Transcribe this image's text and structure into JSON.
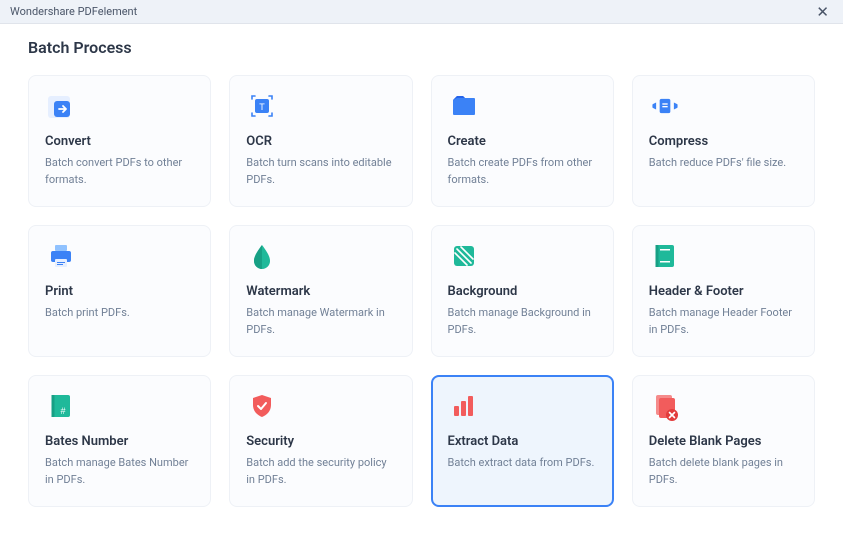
{
  "titlebar": {
    "title": "Wondershare PDFelement"
  },
  "page": {
    "title": "Batch Process"
  },
  "cards": [
    {
      "name": "convert",
      "title": "Convert",
      "desc": "Batch convert PDFs to other formats.",
      "selected": false
    },
    {
      "name": "ocr",
      "title": "OCR",
      "desc": "Batch turn scans into editable PDFs.",
      "selected": false
    },
    {
      "name": "create",
      "title": "Create",
      "desc": "Batch create PDFs from other formats.",
      "selected": false
    },
    {
      "name": "compress",
      "title": "Compress",
      "desc": "Batch reduce PDFs' file size.",
      "selected": false
    },
    {
      "name": "print",
      "title": "Print",
      "desc": "Batch print PDFs.",
      "selected": false
    },
    {
      "name": "watermark",
      "title": "Watermark",
      "desc": "Batch manage Watermark in PDFs.",
      "selected": false
    },
    {
      "name": "background",
      "title": "Background",
      "desc": "Batch manage Background in PDFs.",
      "selected": false
    },
    {
      "name": "header-footer",
      "title": "Header & Footer",
      "desc": "Batch manage Header  Footer in PDFs.",
      "selected": false
    },
    {
      "name": "bates-number",
      "title": "Bates Number",
      "desc": "Batch manage Bates Number in PDFs.",
      "selected": false
    },
    {
      "name": "security",
      "title": "Security",
      "desc": "Batch add the security policy in PDFs.",
      "selected": false
    },
    {
      "name": "extract-data",
      "title": "Extract Data",
      "desc": "Batch extract data from PDFs.",
      "selected": true
    },
    {
      "name": "delete-blank-pages",
      "title": "Delete Blank Pages",
      "desc": "Batch delete blank pages in PDFs.",
      "selected": false
    }
  ]
}
